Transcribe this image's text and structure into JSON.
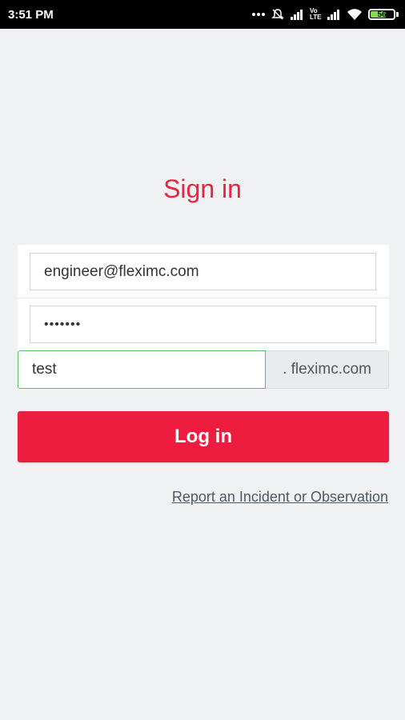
{
  "status_bar": {
    "time": "3:51 PM",
    "volte_label": "Vo LTE",
    "battery_level": "56"
  },
  "page": {
    "title": "Sign in"
  },
  "form": {
    "email_value": "engineer@fleximc.com",
    "password_value": "•••••••",
    "subdomain_value": "test",
    "domain_suffix": ". fleximc.com"
  },
  "actions": {
    "login_label": "Log in",
    "report_link": "Report an Incident or Observation"
  },
  "colors": {
    "accent": "#ee1c3f",
    "title": "#e8243e",
    "focus_border": "#5cc063",
    "background": "#f0f1f3"
  }
}
